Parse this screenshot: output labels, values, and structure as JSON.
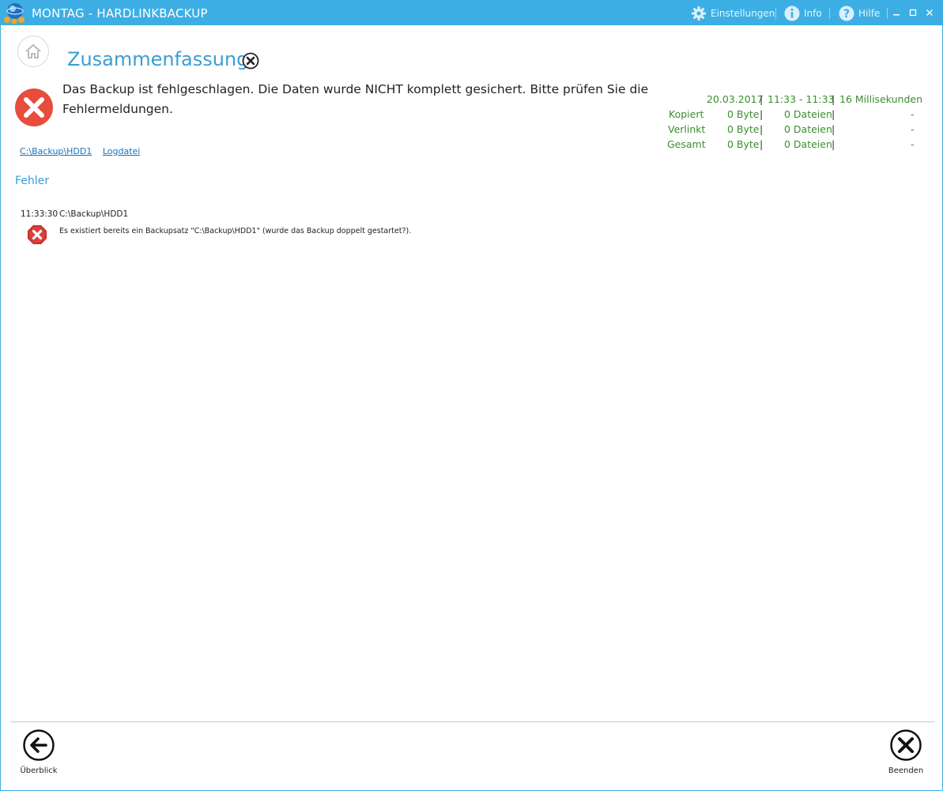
{
  "window": {
    "title": "MONTAG - HARDLINKBACKUP",
    "menu": {
      "settings": "Einstellungen",
      "info": "Info",
      "help": "Hilfe"
    }
  },
  "summary": {
    "title": "Zusammenfassung",
    "message": "Das Backup ist fehlgeschlagen. Die Daten wurde NICHT komplett gesichert. Bitte prüfen Sie die Fehlermeldungen.",
    "links": {
      "path": "C:\\Backup\\HDD1",
      "logfile": "Logdatei"
    }
  },
  "stats": {
    "date": "20.03.2017",
    "timerange": "11:33 - 11:33",
    "duration": "16 Millisekunden",
    "rows": [
      {
        "label": "Kopiert",
        "size": "0 Byte",
        "files": "0 Dateien",
        "extra": "-"
      },
      {
        "label": "Verlinkt",
        "size": "0 Byte",
        "files": "0 Dateien",
        "extra": "-"
      },
      {
        "label": "Gesamt",
        "size": "0 Byte",
        "files": "0 Dateien",
        "extra": "-"
      }
    ]
  },
  "errors": {
    "title": "Fehler",
    "items": [
      {
        "time": "11:33:30",
        "path": "C:\\Backup\\HDD1",
        "message": "Es existiert bereits ein Backupsatz \"C:\\Backup\\HDD1\" (wurde das Backup doppelt gestartet?)."
      }
    ]
  },
  "footer": {
    "back_label": "Überblick",
    "exit_label": "Beenden"
  },
  "colors": {
    "accent": "#3daee3",
    "error": "#e74c3c",
    "stats_green": "#3c8d2f",
    "link": "#1a73b8"
  }
}
